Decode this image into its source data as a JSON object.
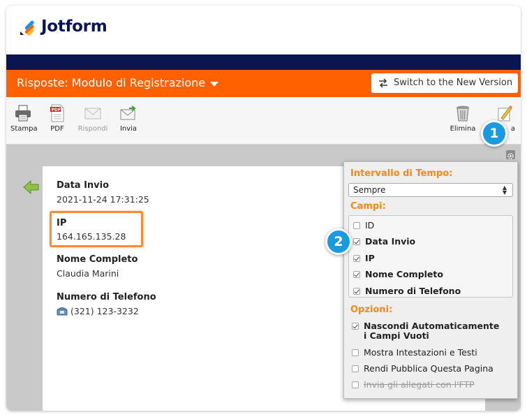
{
  "app": {
    "logo_text": "Jotform"
  },
  "header": {
    "title": "Risposte: Modulo di Registrazione",
    "switch_button": "Switch to the New Version"
  },
  "toolbar": {
    "items": [
      {
        "label": "Stampa",
        "icon": "printer-icon",
        "enabled": true
      },
      {
        "label": "PDF",
        "icon": "pdf-icon",
        "enabled": true
      },
      {
        "label": "Rispondi",
        "icon": "mail-reply-icon",
        "enabled": false
      },
      {
        "label": "Invia",
        "icon": "mail-forward-icon",
        "enabled": true
      },
      {
        "label": "Elimina",
        "icon": "trash-icon",
        "enabled": true
      },
      {
        "label": "a",
        "icon": "edit-icon",
        "enabled": true
      }
    ]
  },
  "submission": {
    "fields": [
      {
        "label": "Data Invio",
        "value": "2021-11-24 17:31:25"
      },
      {
        "label": "IP",
        "value": "164.165.135.28"
      },
      {
        "label": "Nome Completo",
        "value": "Claudia Marini"
      },
      {
        "label": "Numero di Telefono",
        "value": "(321) 123-3232"
      }
    ]
  },
  "panel": {
    "time_label": "Intervallo di Tempo:",
    "time_value": "Sempre",
    "fields_label": "Campi:",
    "fields": [
      {
        "label": "ID",
        "checked": false,
        "bold": false
      },
      {
        "label": "Data Invio",
        "checked": true,
        "bold": true
      },
      {
        "label": "IP",
        "checked": true,
        "bold": true
      },
      {
        "label": "Nome Completo",
        "checked": true,
        "bold": true
      },
      {
        "label": "Numero di Telefono",
        "checked": true,
        "bold": true
      }
    ],
    "options_label": "Opzioni:",
    "options": [
      {
        "label_line1": "Nascondi Automaticamente",
        "label_line2": "i Campi Vuoti",
        "checked": true
      },
      {
        "label": "Mostra Intestazioni e Testi",
        "checked": false
      },
      {
        "label": "Rendi Pubblica Questa Pagina",
        "checked": false
      },
      {
        "label": "Invia gli allegati con l'FTP",
        "checked": false,
        "disabled": true
      }
    ]
  },
  "badges": {
    "one": "1",
    "two": "2"
  },
  "colors": {
    "navy": "#0a1551",
    "orange": "#ff6100",
    "badge_blue": "#1a9be0",
    "panel_heading": "#f08a1c"
  }
}
